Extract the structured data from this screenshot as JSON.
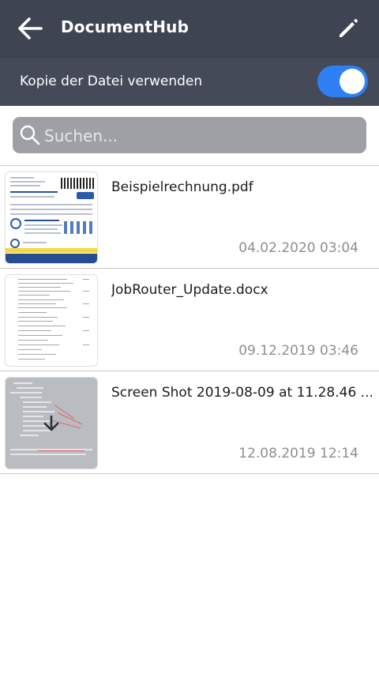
{
  "header": {
    "title": "DocumentHub",
    "back_icon": "arrow-left-icon",
    "edit_icon": "pencil-icon"
  },
  "settings": {
    "copy_file_label": "Kopie der Datei verwenden",
    "copy_file_enabled": true,
    "accent_color": "#2f7ff4"
  },
  "search": {
    "placeholder": "Suchen...",
    "value": ""
  },
  "files": [
    {
      "name": "Beispielrechnung.pdf",
      "date": "04.02.2020 03:04"
    },
    {
      "name": "JobRouter_Update.docx",
      "date": "09.12.2019 03:46"
    },
    {
      "name": "Screen Shot 2019-08-09 at 11.28.46 ...",
      "date": "12.08.2019 12:14"
    }
  ]
}
